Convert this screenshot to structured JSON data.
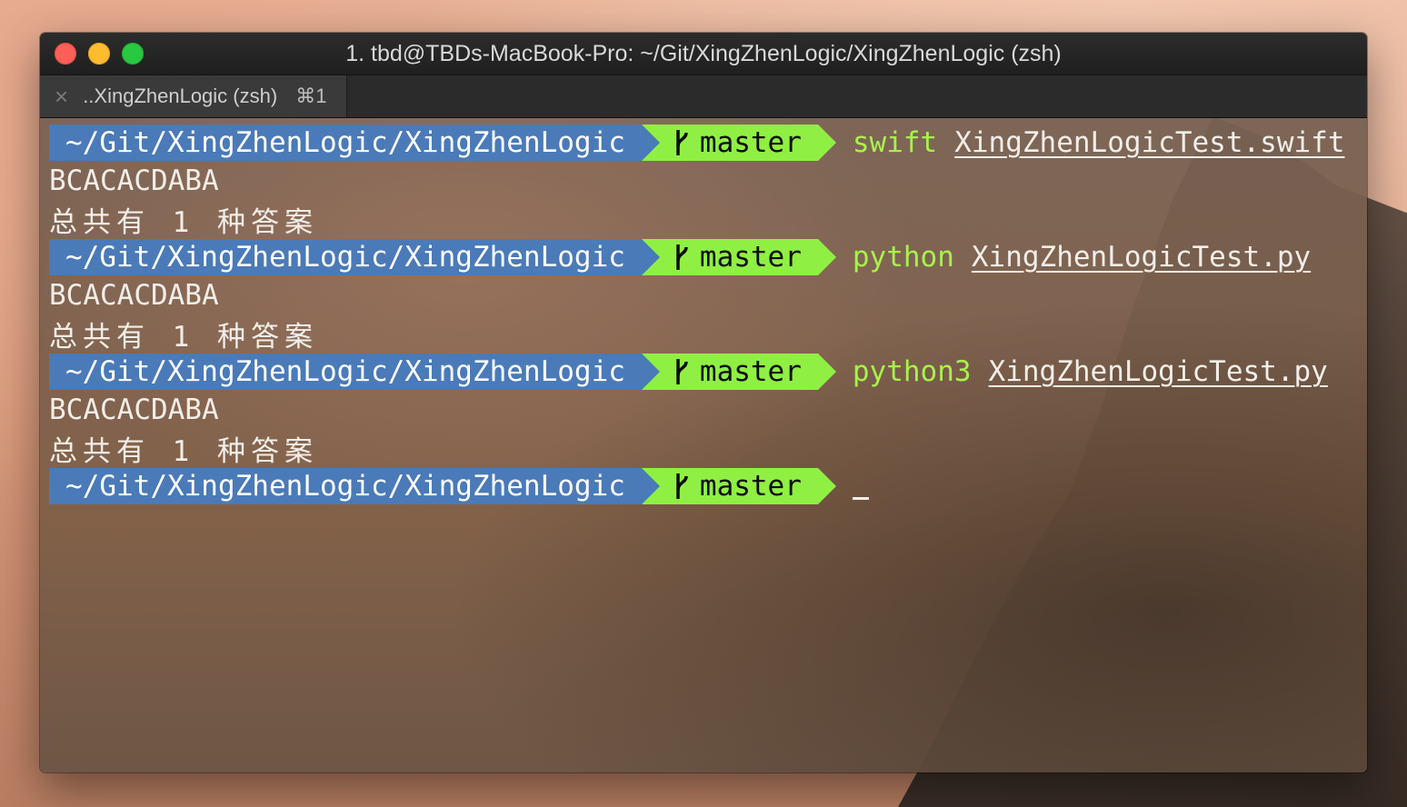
{
  "window": {
    "title": "1. tbd@TBDs-MacBook-Pro: ~/Git/XingZhenLogic/XingZhenLogic (zsh)"
  },
  "tab": {
    "label": "..XingZhenLogic (zsh)",
    "shortcut": "⌘1",
    "close_icon": "close-icon"
  },
  "colors": {
    "path_segment": "#4a7ab8",
    "git_segment": "#8ff043",
    "command": "#a8f14c"
  },
  "terminal": {
    "prompt": {
      "path": "~/Git/XingZhenLogic/XingZhenLogic",
      "branch": "master",
      "branch_icon": "git-branch-icon"
    },
    "commands": [
      {
        "cmd": "swift",
        "arg": "XingZhenLogicTest.swift"
      },
      {
        "cmd": "python",
        "arg": "XingZhenLogicTest.py"
      },
      {
        "cmd": "python3",
        "arg": "XingZhenLogicTest.py"
      }
    ],
    "outputs": [
      {
        "result": "BCACACDABA",
        "summary": "总共有 1 种答案"
      },
      {
        "result": "BCACACDABA",
        "summary": "总共有 1 种答案"
      },
      {
        "result": "BCACACDABA",
        "summary": "总共有 1 种答案"
      }
    ]
  }
}
